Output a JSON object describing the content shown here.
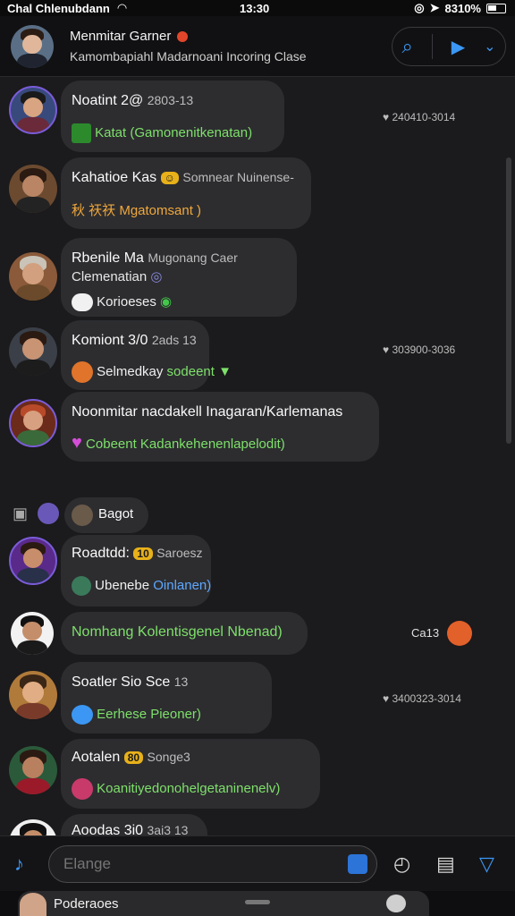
{
  "status_bar": {
    "carrier": "Chal Chlenubdann",
    "time": "13:30",
    "battery": "8310%"
  },
  "header": {
    "title": "Menmitar Garner",
    "subtitle": "Kamombapiahl Madarnoani Incoring Clase"
  },
  "chats": [
    {
      "name": "Noatint 2@",
      "meta_inline": "2803-13",
      "message": "Katat (Gamonenitkenatan)",
      "timestamp": "240410-3014",
      "msg_color": "green"
    },
    {
      "name": "Kahatioe Kas",
      "meta_inline": "Somnear Nuinense-",
      "message": "秋 祆祆 Mgatomsant )",
      "msg_color": "orange"
    },
    {
      "name": "Rbenile Ma",
      "meta_inline": "Mugonang Caer",
      "second_line": "Clemenatian",
      "message": "Korioeses",
      "msg_color": "white"
    },
    {
      "name": "Komiont 3/0",
      "meta_inline": "2ads 13",
      "message": "Selmedkay",
      "message_extra": "sodeent",
      "timestamp": "303900-3036",
      "msg_color": "white"
    },
    {
      "name": "Noonmitar nacdakell Inagaran/Karlemanas",
      "message": "Cobeent Kadankehenenlapelodit)",
      "msg_color": "green"
    },
    {
      "name": "Bagot",
      "is_system": true
    },
    {
      "name": "Roadtdd:",
      "badge": "10",
      "meta_inline": "Saroesz",
      "message": "Ubenebe",
      "message_extra": "Oinlanen)",
      "msg_color": "white"
    },
    {
      "name": "",
      "message": "Nomhang Kolentisgenel Nbenad)",
      "timestamp": "Ca13",
      "msg_color": "green"
    },
    {
      "name": "Soatler Sio Sce",
      "meta_inline": "13",
      "message": "Eerhese Pieoner)",
      "timestamp": "3400323-3014",
      "msg_color": "green"
    },
    {
      "name": "Aotalen",
      "badge": "80",
      "meta_inline": "Songe3",
      "message": "Koanitiyedonohelgetaninenelv)",
      "msg_color": "green"
    },
    {
      "name": "Aoodas 3i0",
      "meta_inline": "3ai3 13"
    }
  ],
  "composer": {
    "placeholder": "Elange"
  },
  "bottom": {
    "label": "Poderaoes"
  },
  "icons": {
    "search": "search-icon",
    "video": "video-icon",
    "chevron": "chevron-down-icon"
  }
}
